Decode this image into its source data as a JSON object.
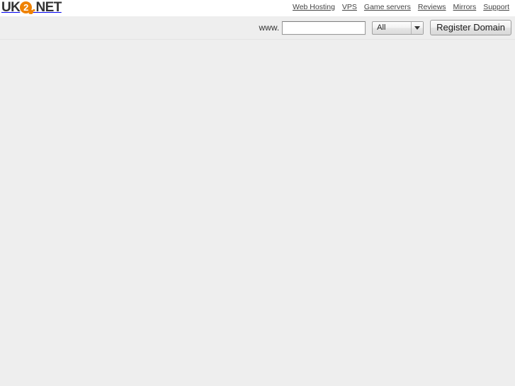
{
  "brand": {
    "logo_prefix": "UK",
    "logo_badge_text": "2",
    "logo_dot": ".",
    "logo_suffix": "NET",
    "logo_alt": "UK2.NET",
    "accent_color": "#ef8200",
    "text_color": "#333333"
  },
  "nav": {
    "items": [
      {
        "label": "Web Hosting",
        "name": "nav-web-hosting"
      },
      {
        "label": "VPS",
        "name": "nav-vps"
      },
      {
        "label": "Game servers",
        "name": "nav-game-servers"
      },
      {
        "label": "Reviews",
        "name": "nav-reviews"
      },
      {
        "label": "Mirrors",
        "name": "nav-mirrors"
      },
      {
        "label": "Support",
        "name": "nav-support"
      }
    ]
  },
  "search": {
    "prefix_label": "www.",
    "domain_value": "",
    "domain_placeholder": "",
    "tld_selected": "All",
    "tld_options": [
      "All"
    ],
    "dropdown_icon": "chevron-down-icon",
    "submit_label": "Register Domain"
  },
  "page": {
    "background_color": "#eeeeee",
    "content": ""
  }
}
